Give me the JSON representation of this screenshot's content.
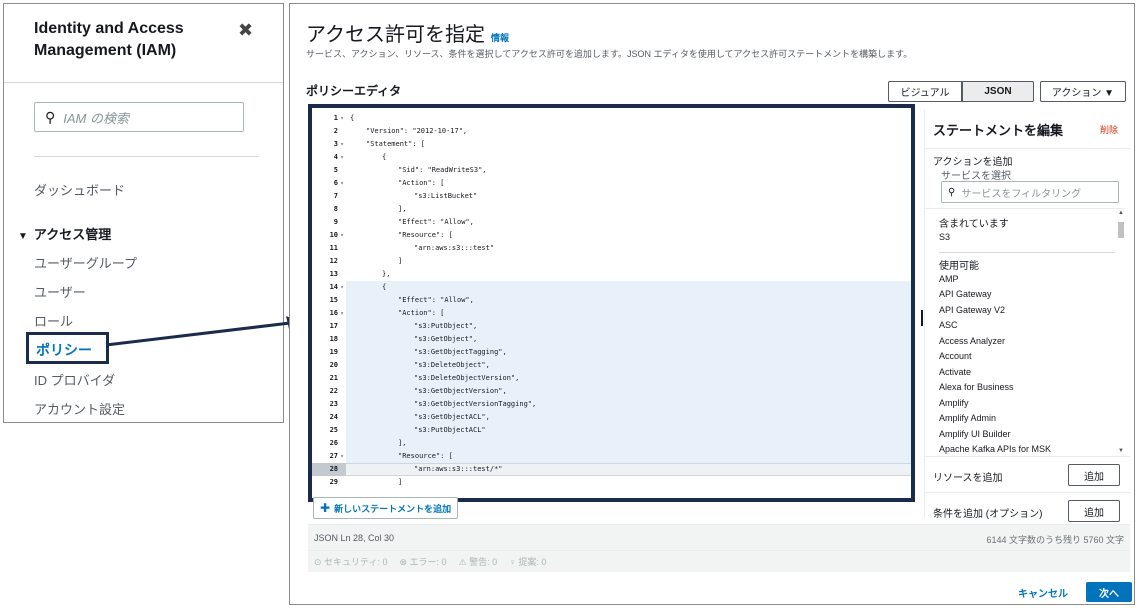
{
  "sidebar": {
    "title": "Identity and Access Management (IAM)",
    "close_glyph": "✖",
    "search_placeholder": "IAM の検索",
    "dashboard": "ダッシュボード",
    "section": "アクセス管理",
    "items": [
      "ユーザーグループ",
      "ユーザー",
      "ロール",
      "ポリシー",
      "ID プロバイダ",
      "アカウント設定"
    ]
  },
  "main": {
    "title": "アクセス許可を指定",
    "info": "情報",
    "subtitle": "サービス、アクション、リソース、条件を選択してアクセス許可を追加します。JSON エディタを使用してアクセス許可ステートメントを構築します。",
    "editor_title": "ポリシーエディタ",
    "tabs": {
      "visual": "ビジュアル",
      "json": "JSON",
      "action": "アクション ▼"
    },
    "add_statement": "新しいステートメントを追加",
    "status_position": "JSON  Ln 28, Col 30",
    "status_count": "6144 文字数のうち残り 5760 文字",
    "warnings": [
      "⊙ セキュリティ: 0",
      "⊗ エラー: 0",
      "⚠ 警告: 0",
      "♀ 提案: 0"
    ],
    "cancel": "キャンセル",
    "next": "次へ"
  },
  "code": [
    {
      "n": "1",
      "fold": "▾",
      "indent": 0,
      "text": "{"
    },
    {
      "n": "2",
      "fold": "",
      "indent": 1,
      "text": "\"Version\": \"2012-10-17\","
    },
    {
      "n": "3",
      "fold": "▾",
      "indent": 1,
      "text": "\"Statement\": ["
    },
    {
      "n": "4",
      "fold": "▾",
      "indent": 2,
      "text": "{"
    },
    {
      "n": "5",
      "fold": "",
      "indent": 3,
      "text": "\"Sid\": \"ReadWriteS3\","
    },
    {
      "n": "6",
      "fold": "▾",
      "indent": 3,
      "text": "\"Action\": ["
    },
    {
      "n": "7",
      "fold": "",
      "indent": 4,
      "text": "\"s3:ListBucket\""
    },
    {
      "n": "8",
      "fold": "",
      "indent": 3,
      "text": "],"
    },
    {
      "n": "9",
      "fold": "",
      "indent": 3,
      "text": "\"Effect\": \"Allow\","
    },
    {
      "n": "10",
      "fold": "▾",
      "indent": 3,
      "text": "\"Resource\": ["
    },
    {
      "n": "11",
      "fold": "",
      "indent": 4,
      "text": "\"arn:aws:s3:::test\""
    },
    {
      "n": "12",
      "fold": "",
      "indent": 3,
      "text": "]"
    },
    {
      "n": "13",
      "fold": "",
      "indent": 2,
      "text": "},"
    },
    {
      "n": "14",
      "fold": "▾",
      "indent": 2,
      "text": "{"
    },
    {
      "n": "15",
      "fold": "",
      "indent": 3,
      "text": "\"Effect\": \"Allow\","
    },
    {
      "n": "16",
      "fold": "▾",
      "indent": 3,
      "text": "\"Action\": ["
    },
    {
      "n": "17",
      "fold": "",
      "indent": 4,
      "text": "\"s3:PutObject\","
    },
    {
      "n": "18",
      "fold": "",
      "indent": 4,
      "text": "\"s3:GetObject\","
    },
    {
      "n": "19",
      "fold": "",
      "indent": 4,
      "text": "\"s3:GetObjectTagging\","
    },
    {
      "n": "20",
      "fold": "",
      "indent": 4,
      "text": "\"s3:DeleteObject\","
    },
    {
      "n": "21",
      "fold": "",
      "indent": 4,
      "text": "\"s3:DeleteObjectVersion\","
    },
    {
      "n": "22",
      "fold": "",
      "indent": 4,
      "text": "\"s3:GetObjectVersion\","
    },
    {
      "n": "23",
      "fold": "",
      "indent": 4,
      "text": "\"s3:GetObjectVersionTagging\","
    },
    {
      "n": "24",
      "fold": "",
      "indent": 4,
      "text": "\"s3:GetObjectACL\","
    },
    {
      "n": "25",
      "fold": "",
      "indent": 4,
      "text": "\"s3:PutObjectACL\""
    },
    {
      "n": "26",
      "fold": "",
      "indent": 3,
      "text": "],"
    },
    {
      "n": "27",
      "fold": "▾",
      "indent": 3,
      "text": "\"Resource\": ["
    },
    {
      "n": "28",
      "fold": "",
      "indent": 4,
      "text": "\"arn:aws:s3:::test/*\""
    },
    {
      "n": "29",
      "fold": "",
      "indent": 3,
      "text": "]"
    }
  ],
  "statement_panel": {
    "title": "ステートメントを編集",
    "delete": "削除",
    "add_action": "アクションを追加",
    "select_service": "サービスを選択",
    "filter_placeholder": "サービスをフィルタリング",
    "included_label": "含まれています",
    "included": [
      "S3"
    ],
    "available_label": "使用可能",
    "available": [
      "AMP",
      "API Gateway",
      "API Gateway V2",
      "ASC",
      "Access Analyzer",
      "Account",
      "Activate",
      "Alexa for Business",
      "Amplify",
      "Amplify Admin",
      "Amplify UI Builder",
      "Apache Kafka APIs for MSK"
    ],
    "add_resource": "リソースを追加",
    "add_condition": "条件を追加 (オプション)",
    "add_button": "追加"
  }
}
